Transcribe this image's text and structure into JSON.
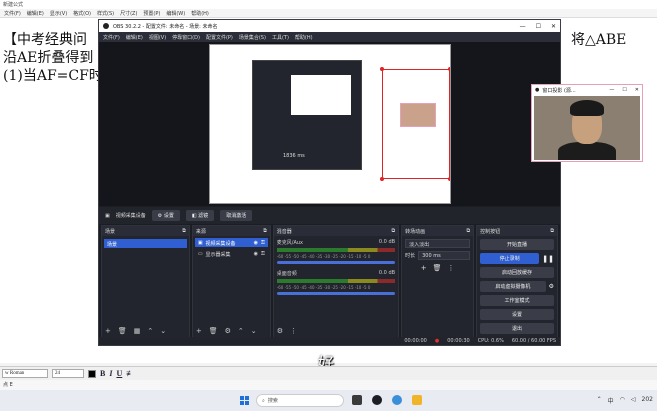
{
  "app": {
    "title": "新建公式",
    "menu": [
      "文件(F)",
      "编辑(E)",
      "显示(V)",
      "格式(O)",
      "样式(S)",
      "尺寸(Z)",
      "预置(P)",
      "编辑(W)",
      "帮助(H)"
    ]
  },
  "doc": {
    "line1_left": "【中考经典问",
    "line1_right": "将△ABE",
    "line2": "沿AE折叠得到",
    "line3": "(1)当AF=CF时"
  },
  "obs": {
    "title": "OBS 30.2.2 - 配置文件: 未命名 - 场景: 未命名",
    "menu": [
      "文件(F)",
      "编辑(E)",
      "视图(V)",
      "停靠窗口(D)",
      "配置文件(P)",
      "场景集合(S)",
      "工具(T)",
      "帮助(H)"
    ],
    "toolbar": {
      "source_label": "视频采集设备",
      "settings_label": "设置",
      "filters_label": "滤镜",
      "deactivate_label": "取消激活"
    },
    "scenes": {
      "header": "场景",
      "items": [
        "场景"
      ]
    },
    "sources": {
      "header": "来源",
      "items": [
        "视频采集设备",
        "显示器采集"
      ]
    },
    "mixer": {
      "header": "混音器",
      "tracks": [
        {
          "name": "麦克风/Aux",
          "level": "0.0 dB"
        },
        {
          "name": "桌面音频",
          "level": "0.0 dB"
        }
      ],
      "scale": "-60 -55 -50 -45 -40 -35 -30 -25 -20 -15 -10 -5 0"
    },
    "transitions": {
      "header": "转场动画",
      "type": "淡入淡出",
      "duration_label": "时长",
      "duration_value": "300 ms"
    },
    "controls": {
      "header": "控制按钮",
      "buttons": [
        "开始直播",
        "停止录制",
        "启动回放缓存",
        "启动虚拟摄像机",
        "工作室模式",
        "设置",
        "退出"
      ]
    },
    "status": {
      "stream_time": "00:00:00",
      "rec_time": "00:00:30",
      "cpu": "CPU: 0.6%",
      "fps": "60.00 / 60.00 FPS"
    },
    "preview_text": {
      "a": "1836 ms"
    }
  },
  "cam": {
    "title": "窗口投影 (源..."
  },
  "subtitle": "好",
  "format_bar": {
    "font": "w Roman",
    "size": "24",
    "bold": "B",
    "italic": "I",
    "underline": "U"
  },
  "page_strip": "点 E",
  "taskbar": {
    "search_placeholder": "搜索",
    "clock": "202"
  },
  "colors": {
    "obs_bg": "#1b1d24",
    "accent": "#2f5fd0",
    "red_frame": "#e02424"
  }
}
